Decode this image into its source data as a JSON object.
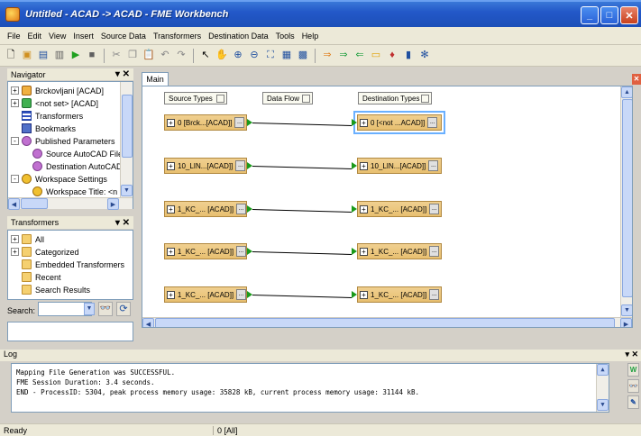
{
  "window": {
    "title": "Untitled - ACAD -> ACAD - FME Workbench"
  },
  "menu": [
    "File",
    "Edit",
    "View",
    "Insert",
    "Source Data",
    "Transformers",
    "Destination Data",
    "Tools",
    "Help"
  ],
  "toolbar": {
    "icons": [
      "new-icon",
      "open-icon",
      "save-icon",
      "print-icon",
      "run-icon",
      "stop-icon",
      "cut-icon",
      "copy-icon",
      "paste-icon",
      "undo-icon",
      "redo-icon",
      "select-icon",
      "pan-icon",
      "zoom-in-icon",
      "zoom-out-icon",
      "zoom-extents-icon",
      "fit-icon",
      "table-icon",
      "ruler-icon",
      "add-reader-icon",
      "add-writer-icon",
      "add-transformer-icon",
      "annotation-icon",
      "bookmark-icon",
      "inspect-icon",
      "settings-icon"
    ]
  },
  "navigator": {
    "title": "Navigator",
    "items": [
      {
        "label": "Brckovljani [ACAD]",
        "icon": "reader",
        "indent": 0,
        "expander": "+"
      },
      {
        "label": "<not set> [ACAD]",
        "icon": "writer",
        "indent": 0,
        "expander": "+"
      },
      {
        "label": "Transformers",
        "icon": "list",
        "indent": 0,
        "expander": ""
      },
      {
        "label": "Bookmarks",
        "icon": "book",
        "indent": 0,
        "expander": ""
      },
      {
        "label": "Published Parameters",
        "icon": "gear",
        "indent": 0,
        "expander": "-"
      },
      {
        "label": "Source AutoCAD File",
        "icon": "gear",
        "indent": 1,
        "expander": ""
      },
      {
        "label": "Destination AutoCAD",
        "icon": "gear",
        "indent": 1,
        "expander": ""
      },
      {
        "label": "Workspace Settings",
        "icon": "gear2",
        "indent": 0,
        "expander": "-"
      },
      {
        "label": "Workspace Title: <n",
        "icon": "gear2",
        "indent": 1,
        "expander": ""
      }
    ]
  },
  "transformers_panel": {
    "title": "Transformers",
    "items": [
      {
        "label": "All",
        "expander": "+"
      },
      {
        "label": "Categorized",
        "expander": "+"
      },
      {
        "label": "Embedded Transformers",
        "expander": ""
      },
      {
        "label": "Recent",
        "expander": ""
      },
      {
        "label": "Search Results",
        "expander": ""
      }
    ],
    "search_label": "Search:",
    "search_value": ""
  },
  "canvas": {
    "tab": "Main",
    "headers": {
      "source": "Source Types",
      "flow": "Data Flow",
      "dest": "Destination Types"
    },
    "sources": [
      "0 [Brck...[ACAD]]",
      "10_LIN...[ACAD]]",
      "1_KC_... [ACAD]]",
      "1_KC_... [ACAD]]",
      "1_KC_... [ACAD]]"
    ],
    "destinations": [
      "0 [<not ...ACAD]]",
      "10_LIN...[ACAD]]",
      "1_KC_... [ACAD]]",
      "1_KC_... [ACAD]]",
      "1_KC_... [ACAD]]"
    ],
    "selected_destination": 0
  },
  "log": {
    "title": "Log",
    "lines": [
      "Mapping File Generation was SUCCESSFUL.",
      "FME Session Duration: 3.4 seconds.",
      "END - ProcessID: 5304, peak process memory usage: 35828 kB, current process memory usage: 31144 kB."
    ]
  },
  "status": {
    "left": "Ready",
    "middle": "0 [All]"
  }
}
